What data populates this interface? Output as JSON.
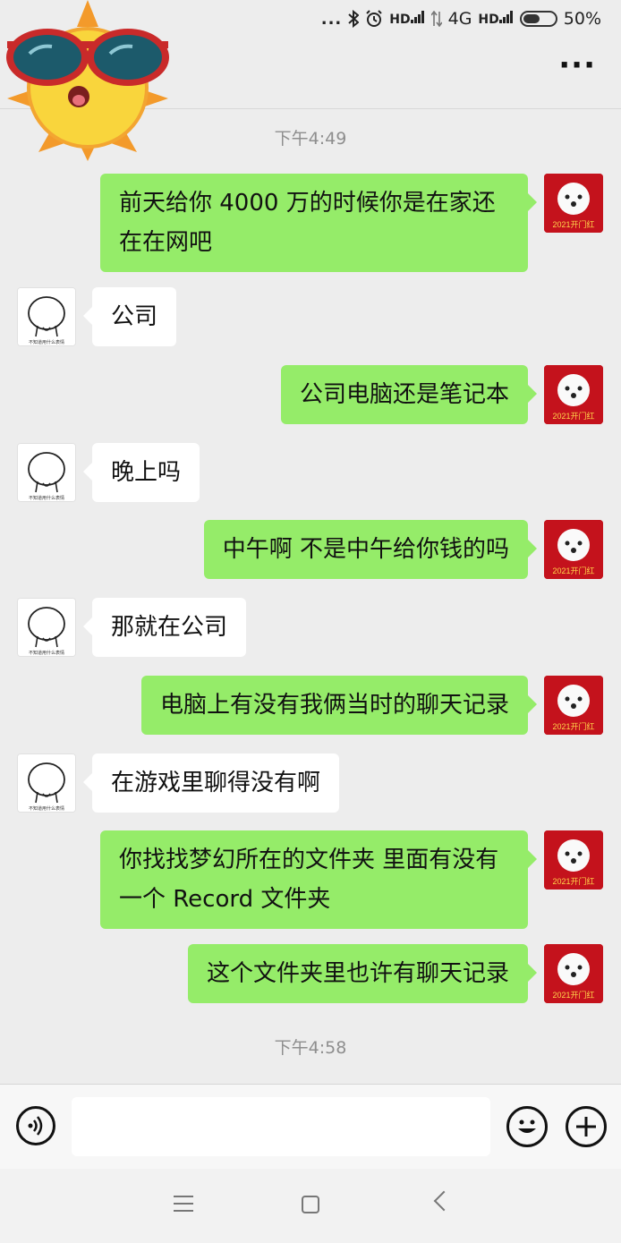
{
  "status_bar": {
    "icons": [
      "more-dots-icon",
      "bluetooth-icon",
      "alarm-icon",
      "hd-signal-icon",
      "data-arrows-icon",
      "hd-signal-icon",
      "battery-icon"
    ],
    "dots": "...",
    "network": "4G",
    "hd": "HD",
    "battery": "50%"
  },
  "header": {
    "more_label": "···"
  },
  "chat": {
    "timestamps": [
      "下午4:49",
      "下午4:58"
    ],
    "messages": [
      {
        "side": "me",
        "text": "前天给你 4000 万的时候你是在家还在在网吧"
      },
      {
        "side": "other",
        "text": "公司"
      },
      {
        "side": "me",
        "text": "公司电脑还是笔记本"
      },
      {
        "side": "other",
        "text": "晚上吗"
      },
      {
        "side": "me",
        "text": "中午啊 不是中午给你钱的吗"
      },
      {
        "side": "other",
        "text": "那就在公司"
      },
      {
        "side": "me",
        "text": "电脑上有没有我俩当时的聊天记录"
      },
      {
        "side": "other",
        "text": "在游戏里聊得没有啊"
      },
      {
        "side": "me",
        "text": "你找找梦幻所在的文件夹 里面有没有一个 Record 文件夹"
      },
      {
        "side": "me",
        "text": "这个文件夹里也许有聊天记录"
      }
    ]
  },
  "avatars": {
    "me_caption": "2021开门红",
    "other_caption": "不知道用什么表情"
  },
  "input_bar": {
    "value": "",
    "icons": [
      "voice-icon",
      "emoji-icon",
      "plus-icon"
    ]
  },
  "nav_bar": {
    "icons": [
      "menu-icon",
      "home-icon",
      "back-icon"
    ]
  },
  "colors": {
    "my_bubble": "#95ec69",
    "other_bubble": "#ffffff",
    "background": "#ededed"
  }
}
